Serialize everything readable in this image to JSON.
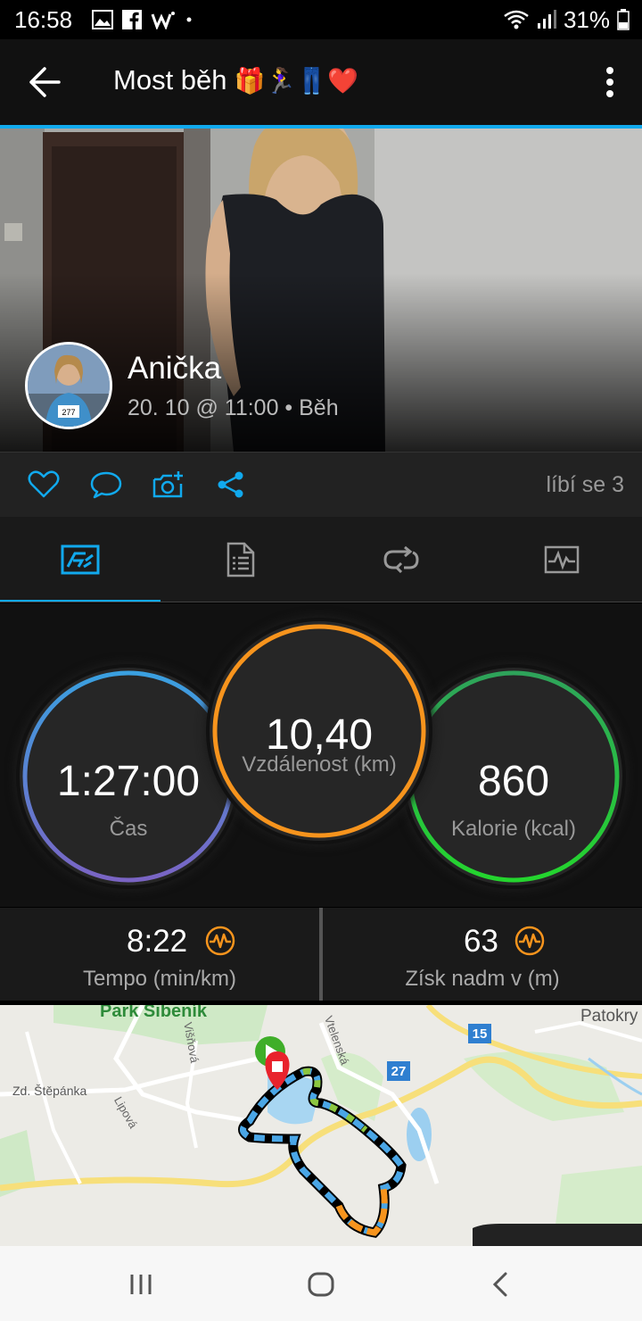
{
  "status_bar": {
    "time": "16:58",
    "battery": "31%"
  },
  "app_bar": {
    "title": "Most běh",
    "emojis": "🎁🏃‍♀️👖❤️"
  },
  "profile": {
    "name": "Anička",
    "meta": "20. 10 @ 11:00 • Běh"
  },
  "actions": {
    "likes": "líbí se 3"
  },
  "tabs": [
    {
      "name": "overview",
      "icon": "activity-overview-icon",
      "active": true
    },
    {
      "name": "details",
      "icon": "document-icon",
      "active": false
    },
    {
      "name": "laps",
      "icon": "laps-icon",
      "active": false
    },
    {
      "name": "charts",
      "icon": "chart-icon",
      "active": false
    }
  ],
  "stats": {
    "time": {
      "value": "1:27:00",
      "label": "Čas"
    },
    "distance": {
      "value": "10,40",
      "label": "Vzdálenost (km)"
    },
    "calories": {
      "value": "860",
      "label": "Kalorie (kcal)"
    },
    "pace": {
      "value": "8:22",
      "label": "Tempo (min/km)"
    },
    "elevation": {
      "value": "63",
      "label": "Získ nadm v (m)"
    }
  },
  "map": {
    "labels": {
      "park": "Park Šibeník",
      "patokry": "Patokry",
      "stepanka": "Zd. Štěpánka",
      "lipova": "Lipová",
      "visnova": "Višňová",
      "vtelenska": "Vtelenská"
    },
    "road_badges": {
      "r15": "15",
      "r27": "27"
    }
  },
  "colors": {
    "accent": "#11a9ed",
    "time_ring": "#5b8fd8",
    "distance_ring": "#f7941d",
    "calories_ring": "#22c55e"
  }
}
